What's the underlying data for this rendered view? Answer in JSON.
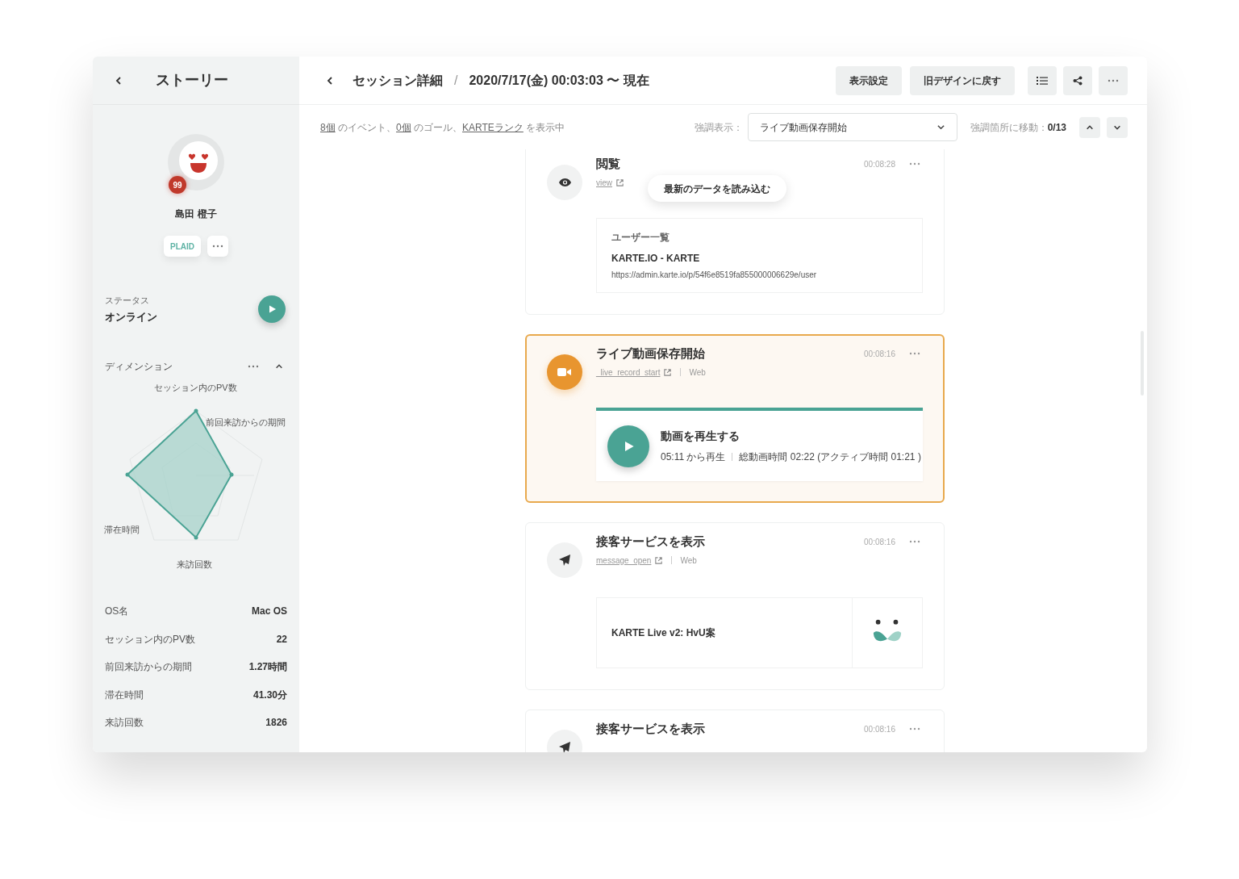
{
  "sidebar": {
    "title": "ストーリー",
    "profile": {
      "badge": "99",
      "name": "島田 橙子",
      "tag": "PLAID"
    },
    "status": {
      "label": "ステータス",
      "value": "オンライン"
    },
    "dimension": {
      "title": "ディメンション",
      "expanded": true,
      "radar_labels": [
        "セッション内のPV数",
        "前回来訪からの期間",
        "滞在時間",
        "来訪回数"
      ]
    },
    "attributes": [
      {
        "label": "OS名",
        "value": "Mac OS"
      },
      {
        "label": "セッション内のPV数",
        "value": "22"
      },
      {
        "label": "前回来訪からの期間",
        "value": "1.27時間"
      },
      {
        "label": "滞在時間",
        "value": "41.30分"
      },
      {
        "label": "来訪回数",
        "value": "1826"
      }
    ]
  },
  "header": {
    "title": "セッション詳細",
    "separator": "/",
    "period": "2020/7/17(金) 00:03:03 〜 現在",
    "buttons": [
      "表示設定",
      "旧デザインに戻す"
    ]
  },
  "summary": [
    {
      "text": "8個",
      "link": true
    },
    {
      "text": " のイベント、",
      "link": false
    },
    {
      "text": "0個",
      "link": true
    },
    {
      "text": " のゴール、",
      "link": false
    },
    {
      "text": "KARTEランク",
      "link": true
    },
    {
      "text": " を表示中",
      "link": false
    }
  ],
  "highlight": {
    "label": "強調表示：",
    "value": "ライブ動画保存開始"
  },
  "jump": {
    "text": "強調箇所に移動：**0/13**"
  },
  "tooltip": "最新のデータを読み込む",
  "events": [
    {
      "kind": "view",
      "title": "閲覧",
      "time": "00:08:28",
      "source": "view",
      "selected": false,
      "preview": {
        "heading": "ユーザー一覧",
        "title": "KARTE.IO - KARTE",
        "url": "https://admin.karte.io/p/54f6e8519fa855000006629e/user"
      }
    },
    {
      "kind": "video",
      "title": "ライブ動画保存開始",
      "time": "00:08:16",
      "source": "_live_record_start",
      "channel": "Web",
      "selected": true,
      "preview": {
        "title": "動画を再生する",
        "start": "05:11 から再生",
        "detail": "総動画時間 02:22 (アクティブ時間 01:21 )"
      }
    },
    {
      "kind": "message",
      "title": "接客サービスを表示",
      "time": "00:08:16",
      "source": "message_open",
      "channel": "Web",
      "selected": false,
      "preview": {
        "title": "KARTE Live v2: HvU案"
      }
    },
    {
      "kind": "message",
      "title": "接客サービスを表示",
      "time": "00:08:16",
      "selected": false
    }
  ]
}
